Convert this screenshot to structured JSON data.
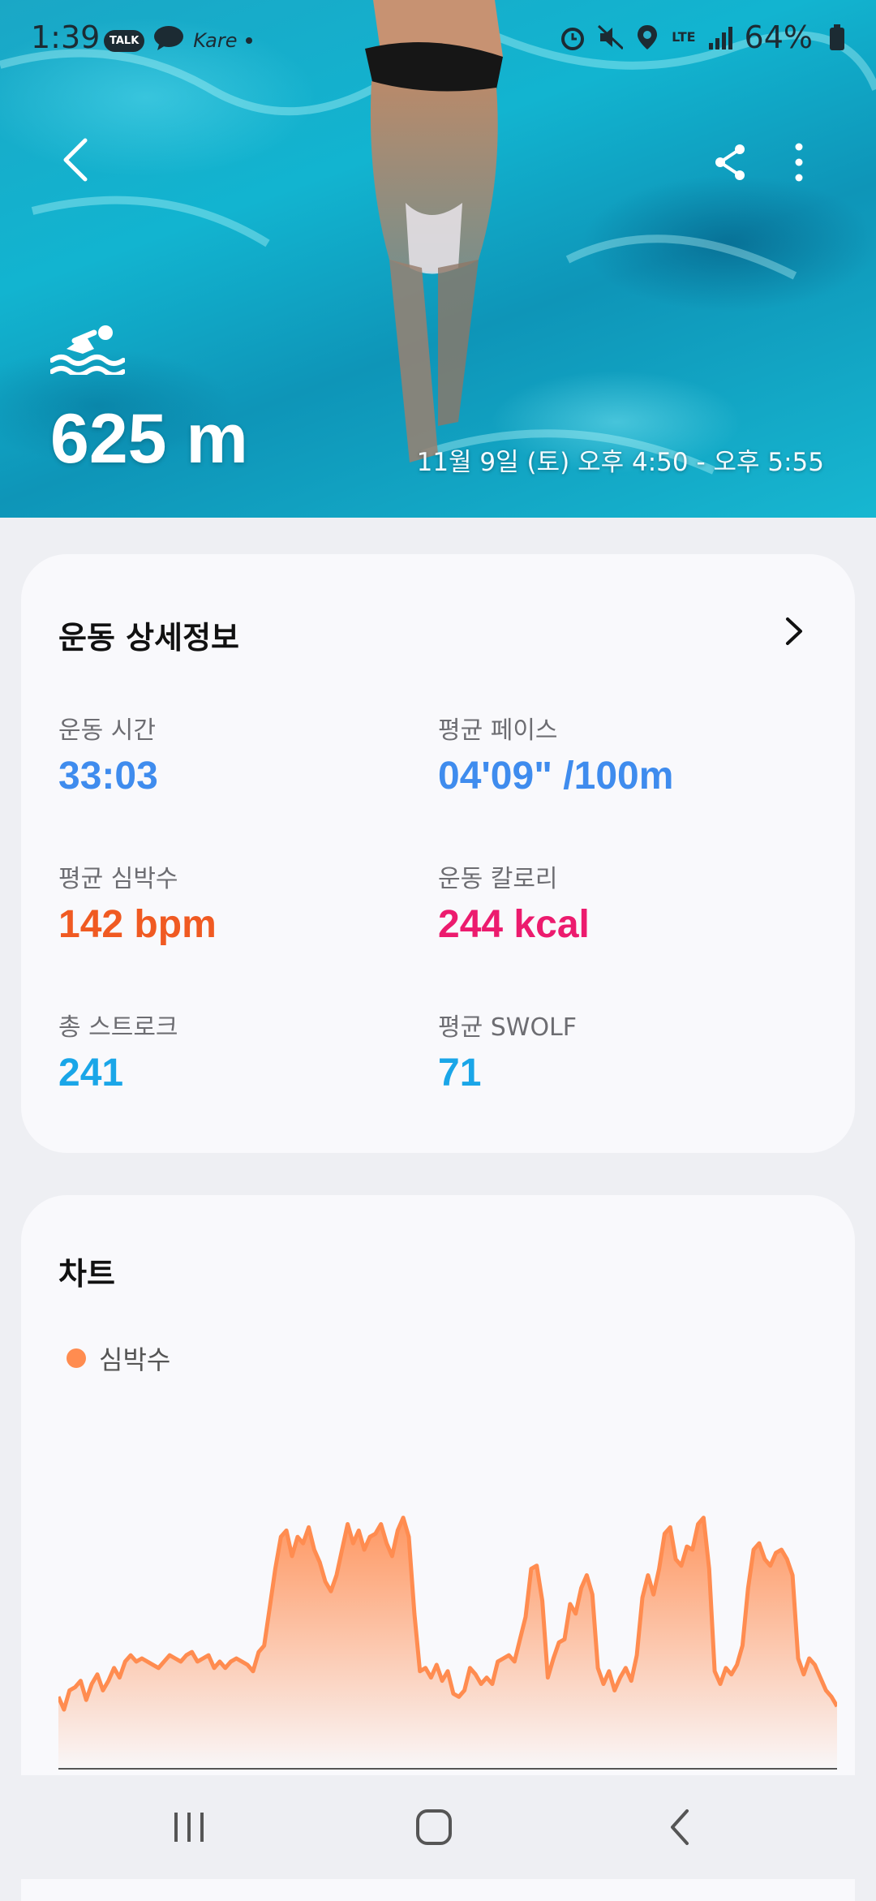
{
  "status_bar": {
    "time": "1:39",
    "talk_badge": "TALK",
    "app_label": "Kare",
    "network": "LTE",
    "battery": "64%"
  },
  "hero": {
    "activity_icon": "swimming-icon",
    "distance": "625 m",
    "time_range": "11월 9일 (토) 오후 4:50 - 오후 5:55"
  },
  "details": {
    "title": "운동 상세정보",
    "metrics": [
      {
        "label": "운동 시간",
        "value": "33:03",
        "color": "#3f8cee"
      },
      {
        "label": "평균 페이스",
        "value": "04'09\" /100m",
        "color": "#3f8cee"
      },
      {
        "label": "평균 심박수",
        "value": "142 bpm",
        "color": "#f05a22"
      },
      {
        "label": "운동 칼로리",
        "value": "244 kcal",
        "color": "#ec1b6e"
      },
      {
        "label": "총 스트로크",
        "value": "241",
        "color": "#1aa6e8"
      },
      {
        "label": "평균 SWOLF",
        "value": "71",
        "color": "#1aa6e8"
      }
    ]
  },
  "chart_section": {
    "title": "차트",
    "legend": "심박수"
  },
  "chart_data": {
    "type": "area",
    "title": "",
    "series": [
      {
        "name": "심박수",
        "color": "#ff8c50",
        "values": [
          122,
          118,
          124,
          125,
          127,
          121,
          126,
          129,
          124,
          127,
          131,
          128,
          133,
          135,
          133,
          134,
          133,
          132,
          131,
          133,
          135,
          134,
          133,
          135,
          136,
          133,
          134,
          135,
          131,
          133,
          131,
          133,
          134,
          133,
          132,
          130,
          136,
          138,
          150,
          162,
          172,
          174,
          166,
          172,
          170,
          175,
          168,
          164,
          158,
          155,
          160,
          168,
          176,
          170,
          174,
          168,
          172,
          173,
          176,
          170,
          166,
          174,
          178,
          172,
          148,
          130,
          131,
          128,
          132,
          127,
          130,
          123,
          122,
          124,
          131,
          129,
          126,
          128,
          126,
          133,
          134,
          135,
          133,
          140,
          147,
          162,
          163,
          152,
          128,
          134,
          139,
          140,
          151,
          148,
          156,
          160,
          154,
          131,
          126,
          130,
          124,
          128,
          131,
          127,
          135,
          153,
          160,
          154,
          162,
          173,
          175,
          165,
          163,
          169,
          168,
          176,
          178,
          162,
          130,
          126,
          131,
          129,
          132,
          138,
          156,
          168,
          170,
          165,
          163,
          167,
          168,
          165,
          160,
          134,
          129,
          134,
          132,
          128,
          124,
          122,
          119
        ]
      }
    ],
    "y_range": [
      100,
      185
    ],
    "grid": false,
    "legend_position": "top-left"
  },
  "navbar": {
    "recent_icon": "recent-apps-icon",
    "home_icon": "home-icon",
    "back_icon": "back-icon"
  }
}
